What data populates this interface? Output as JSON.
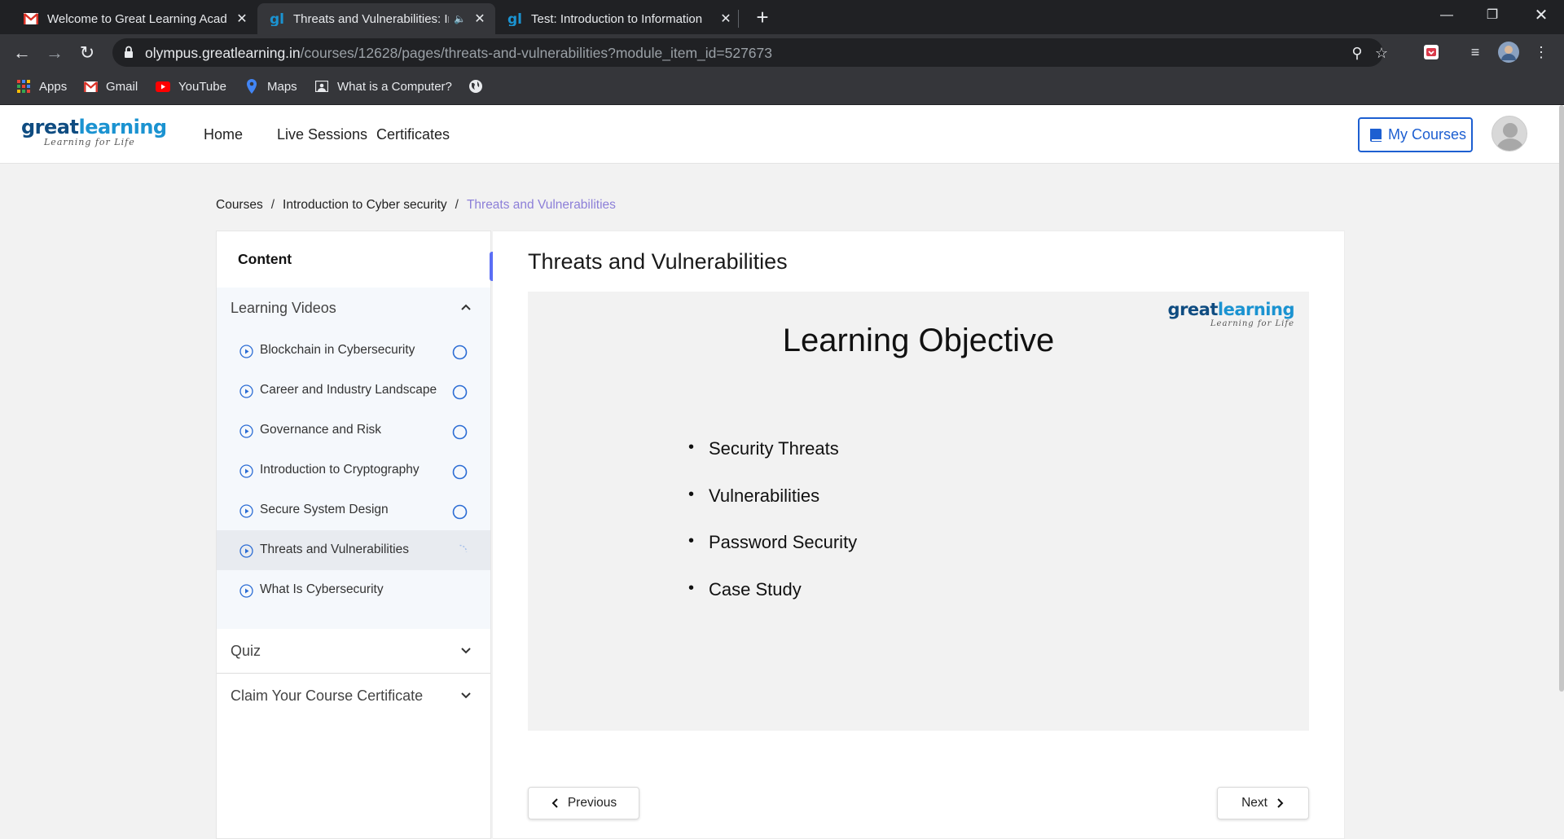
{
  "browser": {
    "tabs": [
      {
        "title": "Welcome to Great Learning Acad",
        "icon": "gmail-icon"
      },
      {
        "title": "Threats and Vulnerabilities: Ir",
        "icon": "greatlearning-icon"
      },
      {
        "title": "Test: Introduction to Information",
        "icon": "greatlearning-icon"
      }
    ],
    "url_host": "olympus.greatlearning.in",
    "url_path": "/courses/12628/pages/threats-and-vulnerabilities?module_item_id=527673",
    "bookmarks": [
      {
        "label": "Apps",
        "icon": "apps-grid-icon"
      },
      {
        "label": "Gmail",
        "icon": "gmail-icon"
      },
      {
        "label": "YouTube",
        "icon": "youtube-icon"
      },
      {
        "label": "Maps",
        "icon": "maps-icon"
      },
      {
        "label": "What is a Computer?",
        "icon": "page-icon"
      }
    ],
    "colors": {
      "chrome_dark": "#202124",
      "chrome_mid": "#35363a"
    }
  },
  "site": {
    "logo_text_a": "great",
    "logo_text_b": "learning",
    "logo_tagline": "Learning for Life",
    "nav": [
      "Home",
      "Live Sessions",
      "Certificates"
    ],
    "my_courses": "My Courses",
    "accent": "#1d5fd1"
  },
  "breadcrumb": [
    "Courses",
    "Introduction to Cyber security",
    "Threats and Vulnerabilities"
  ],
  "sidebar": {
    "title": "Content",
    "sections": [
      {
        "title": "Learning Videos",
        "expanded": true,
        "items": [
          {
            "label": "Blockchain in Cybersecurity",
            "status": "not-started"
          },
          {
            "label": "Career and Industry Landscape",
            "status": "not-started"
          },
          {
            "label": "Governance and Risk",
            "status": "not-started"
          },
          {
            "label": "Introduction to Cryptography",
            "status": "not-started"
          },
          {
            "label": "Secure System Design",
            "status": "not-started"
          },
          {
            "label": "Threats and Vulnerabilities",
            "status": "in-progress"
          },
          {
            "label": "What Is Cybersecurity",
            "status": "none"
          }
        ]
      },
      {
        "title": "Quiz",
        "expanded": false
      },
      {
        "title": "Claim Your Course Certificate",
        "expanded": false
      }
    ]
  },
  "main": {
    "title": "Threats and Vulnerabilities",
    "slide": {
      "logo_text_a": "great",
      "logo_text_b": "learning",
      "logo_tagline": "Learning for Life",
      "heading": "Learning Objective",
      "bullets": [
        "Security Threats",
        "Vulnerabilities",
        "Password Security",
        "Case Study"
      ]
    },
    "previous_label": "Previous",
    "next_label": "Next"
  }
}
